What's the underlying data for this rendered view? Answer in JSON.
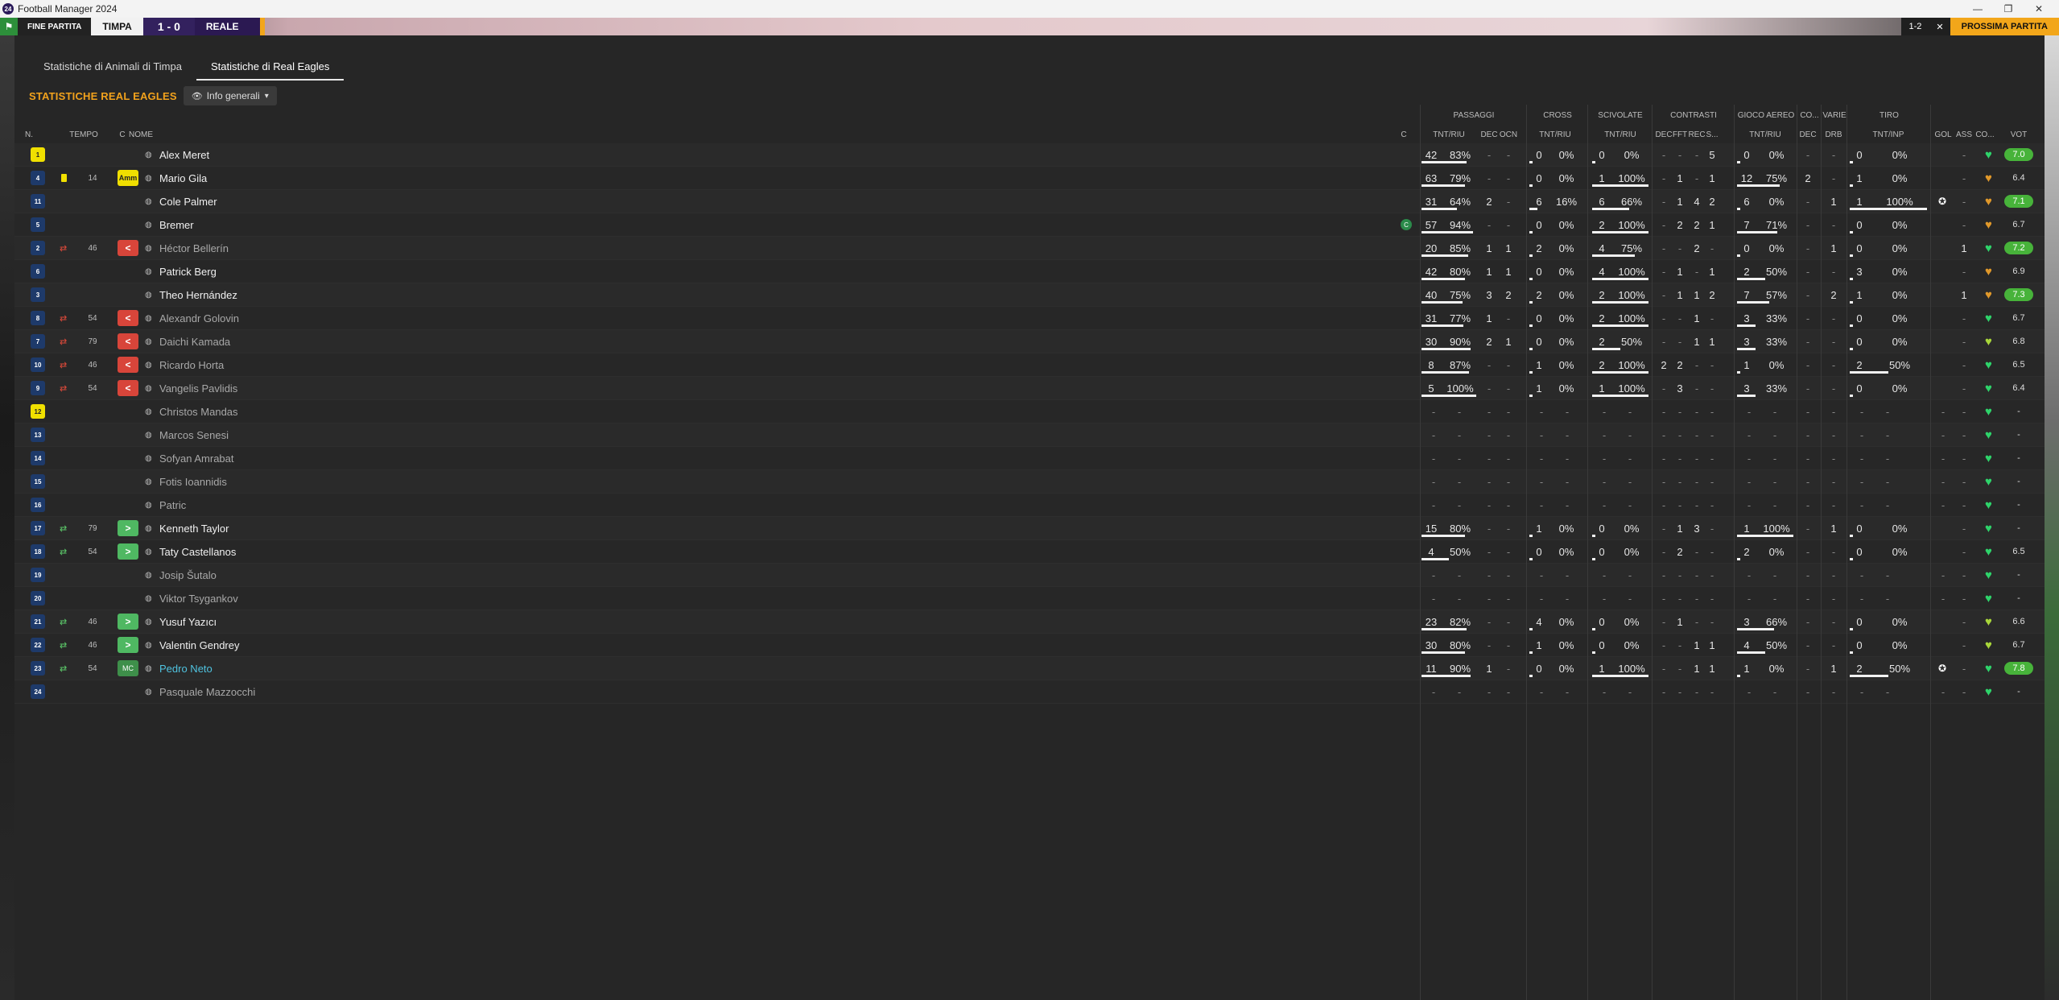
{
  "window": {
    "title": "Football Manager 2024",
    "logo": "24",
    "controls": [
      "—",
      "❐",
      "✕"
    ]
  },
  "topbar": {
    "end_label": "FINE PARTITA",
    "team_home": "TIMPA",
    "score": "1 - 0",
    "team_away": "REALE",
    "right1": "1-2",
    "right2": "✕",
    "right3": "PROSSIMA PARTITA"
  },
  "tabs": [
    {
      "label": "Statistiche di Animali di Timpa",
      "active": false
    },
    {
      "label": "Statistiche di Real Eagles",
      "active": true
    }
  ],
  "section": {
    "title": "STATISTICHE REAL EAGLES",
    "dropdown": "Info generali"
  },
  "columns": {
    "left": {
      "n": "N.",
      "tempo": "TEMPO",
      "c": "C",
      "nome": "NOME",
      "c2": "C"
    },
    "groups": [
      {
        "label": "PASSAGGI"
      },
      {
        "label": "CROSS"
      },
      {
        "label": "SCIVOLATE"
      },
      {
        "label": "CONTRASTI"
      },
      {
        "label": "GIOCO AEREO"
      },
      {
        "label": "CO..."
      },
      {
        "label": "VARIE"
      },
      {
        "label": "TIRO"
      }
    ],
    "sub": [
      "TNT/RIU",
      "DEC",
      "OCN",
      "TNT/RIU",
      "TNT/RIU",
      "DEC",
      "FFT",
      "REC",
      "S...",
      "TNT/RIU",
      "DEC",
      "DRB",
      "TNT/INP",
      "GOL",
      "ASS",
      "CO...",
      "VOT"
    ]
  },
  "colors": {
    "accent": "#f2a21c",
    "sub_off": "#d8453a",
    "sub_on": "#4fb862",
    "rating_green": "#47b33a"
  },
  "players": [
    {
      "num": "1",
      "gk": true,
      "sub": "",
      "card": false,
      "min": "",
      "badge": "",
      "badge_text": "",
      "name": "Alex Meret",
      "dim": false,
      "hl": false,
      "cap": false,
      "pas": [
        "42",
        "83%",
        0.83
      ],
      "dec": "-",
      "ocn": "-",
      "cross": [
        "0",
        "0%",
        0
      ],
      "sciv": [
        "0",
        "0%",
        0
      ],
      "cdec": "-",
      "fft": "-",
      "rec": "-",
      "s": "5",
      "aer": [
        "0",
        "0%",
        0
      ],
      "codec": "-",
      "drb": "-",
      "tiro": [
        "0",
        "0%",
        0
      ],
      "pom": false,
      "gol": "",
      "ass": "-",
      "morale": "green",
      "vot": "7.0",
      "vot_green": true
    },
    {
      "num": "4",
      "gk": false,
      "sub": "",
      "card": true,
      "min": "14",
      "badge": "amm",
      "badge_text": "Amm",
      "name": "Mario Gila",
      "dim": false,
      "hl": false,
      "cap": false,
      "pas": [
        "63",
        "79%",
        0.79
      ],
      "dec": "-",
      "ocn": "-",
      "cross": [
        "0",
        "0%",
        0
      ],
      "sciv": [
        "1",
        "100%",
        1
      ],
      "cdec": "-",
      "fft": "1",
      "rec": "-",
      "s": "1",
      "aer": [
        "12",
        "75%",
        0.75
      ],
      "codec": "2",
      "drb": "-",
      "tiro": [
        "1",
        "0%",
        0
      ],
      "pom": false,
      "gol": "",
      "ass": "-",
      "morale": "orange",
      "vot": "6.4",
      "vot_green": false
    },
    {
      "num": "11",
      "gk": false,
      "sub": "",
      "card": false,
      "min": "",
      "badge": "",
      "badge_text": "",
      "name": "Cole Palmer",
      "dim": false,
      "hl": false,
      "cap": false,
      "pas": [
        "31",
        "64%",
        0.64
      ],
      "dec": "2",
      "ocn": "-",
      "cross": [
        "6",
        "16%",
        0.16
      ],
      "sciv": [
        "6",
        "66%",
        0.66
      ],
      "cdec": "-",
      "fft": "1",
      "rec": "4",
      "s": "2",
      "aer": [
        "6",
        "0%",
        0
      ],
      "codec": "-",
      "drb": "1",
      "tiro": [
        "1",
        "100%",
        1
      ],
      "pom": true,
      "gol": "",
      "ass": "-",
      "morale": "orange",
      "vot": "7.1",
      "vot_green": true
    },
    {
      "num": "5",
      "gk": false,
      "sub": "",
      "card": false,
      "min": "",
      "badge": "",
      "badge_text": "",
      "name": "Bremer",
      "dim": false,
      "hl": false,
      "cap": true,
      "pas": [
        "57",
        "94%",
        0.94
      ],
      "dec": "-",
      "ocn": "-",
      "cross": [
        "0",
        "0%",
        0
      ],
      "sciv": [
        "2",
        "100%",
        1
      ],
      "cdec": "-",
      "fft": "2",
      "rec": "2",
      "s": "1",
      "aer": [
        "7",
        "71%",
        0.71
      ],
      "codec": "-",
      "drb": "-",
      "tiro": [
        "0",
        "0%",
        0
      ],
      "pom": false,
      "gol": "",
      "ass": "-",
      "morale": "orange",
      "vot": "6.7",
      "vot_green": false
    },
    {
      "num": "2",
      "gk": false,
      "sub": "off",
      "card": false,
      "min": "46",
      "badge": "out",
      "badge_text": "<",
      "name": "Héctor Bellerín",
      "dim": true,
      "hl": false,
      "cap": false,
      "pas": [
        "20",
        "85%",
        0.85
      ],
      "dec": "1",
      "ocn": "1",
      "cross": [
        "2",
        "0%",
        0
      ],
      "sciv": [
        "4",
        "75%",
        0.75
      ],
      "cdec": "-",
      "fft": "-",
      "rec": "2",
      "s": "-",
      "aer": [
        "0",
        "0%",
        0
      ],
      "codec": "-",
      "drb": "1",
      "tiro": [
        "0",
        "0%",
        0
      ],
      "pom": false,
      "gol": "",
      "ass": "1",
      "morale": "green",
      "vot": "7.2",
      "vot_green": true
    },
    {
      "num": "6",
      "gk": false,
      "sub": "",
      "card": false,
      "min": "",
      "badge": "",
      "badge_text": "",
      "name": "Patrick Berg",
      "dim": false,
      "hl": false,
      "cap": false,
      "pas": [
        "42",
        "80%",
        0.8
      ],
      "dec": "1",
      "ocn": "1",
      "cross": [
        "0",
        "0%",
        0
      ],
      "sciv": [
        "4",
        "100%",
        1
      ],
      "cdec": "-",
      "fft": "1",
      "rec": "-",
      "s": "1",
      "aer": [
        "2",
        "50%",
        0.5
      ],
      "codec": "-",
      "drb": "-",
      "tiro": [
        "3",
        "0%",
        0
      ],
      "pom": false,
      "gol": "",
      "ass": "-",
      "morale": "orange",
      "vot": "6.9",
      "vot_green": false
    },
    {
      "num": "3",
      "gk": false,
      "sub": "",
      "card": false,
      "min": "",
      "badge": "",
      "badge_text": "",
      "name": "Theo Hernández",
      "dim": false,
      "hl": false,
      "cap": false,
      "pas": [
        "40",
        "75%",
        0.75
      ],
      "dec": "3",
      "ocn": "2",
      "cross": [
        "2",
        "0%",
        0
      ],
      "sciv": [
        "2",
        "100%",
        1
      ],
      "cdec": "-",
      "fft": "1",
      "rec": "1",
      "s": "2",
      "aer": [
        "7",
        "57%",
        0.57
      ],
      "codec": "-",
      "drb": "2",
      "tiro": [
        "1",
        "0%",
        0
      ],
      "pom": false,
      "gol": "",
      "ass": "1",
      "morale": "orange",
      "vot": "7.3",
      "vot_green": true
    },
    {
      "num": "8",
      "gk": false,
      "sub": "off",
      "card": false,
      "min": "54",
      "badge": "out",
      "badge_text": "<",
      "name": "Alexandr Golovin",
      "dim": true,
      "hl": false,
      "cap": false,
      "pas": [
        "31",
        "77%",
        0.77
      ],
      "dec": "1",
      "ocn": "-",
      "cross": [
        "0",
        "0%",
        0
      ],
      "sciv": [
        "2",
        "100%",
        1
      ],
      "cdec": "-",
      "fft": "-",
      "rec": "1",
      "s": "-",
      "aer": [
        "3",
        "33%",
        0.33
      ],
      "codec": "-",
      "drb": "-",
      "tiro": [
        "0",
        "0%",
        0
      ],
      "pom": false,
      "gol": "",
      "ass": "-",
      "morale": "green",
      "vot": "6.7",
      "vot_green": false
    },
    {
      "num": "7",
      "gk": false,
      "sub": "off",
      "card": false,
      "min": "79",
      "badge": "out",
      "badge_text": "<",
      "name": "Daichi Kamada",
      "dim": true,
      "hl": false,
      "cap": false,
      "pas": [
        "30",
        "90%",
        0.9
      ],
      "dec": "2",
      "ocn": "1",
      "cross": [
        "0",
        "0%",
        0
      ],
      "sciv": [
        "2",
        "50%",
        0.5
      ],
      "cdec": "-",
      "fft": "-",
      "rec": "1",
      "s": "1",
      "aer": [
        "3",
        "33%",
        0.33
      ],
      "codec": "-",
      "drb": "-",
      "tiro": [
        "0",
        "0%",
        0
      ],
      "pom": false,
      "gol": "",
      "ass": "-",
      "morale": "yellowgreen",
      "vot": "6.8",
      "vot_green": false
    },
    {
      "num": "10",
      "gk": false,
      "sub": "off",
      "card": false,
      "min": "46",
      "badge": "out",
      "badge_text": "<",
      "name": "Ricardo Horta",
      "dim": true,
      "hl": false,
      "cap": false,
      "pas": [
        "8",
        "87%",
        0.87
      ],
      "dec": "-",
      "ocn": "-",
      "cross": [
        "1",
        "0%",
        0
      ],
      "sciv": [
        "2",
        "100%",
        1
      ],
      "cdec": "2",
      "fft": "2",
      "rec": "-",
      "s": "-",
      "aer": [
        "1",
        "0%",
        0
      ],
      "codec": "-",
      "drb": "-",
      "tiro": [
        "2",
        "50%",
        0.5
      ],
      "pom": false,
      "gol": "",
      "ass": "-",
      "morale": "green",
      "vot": "6.5",
      "vot_green": false
    },
    {
      "num": "9",
      "gk": false,
      "sub": "off",
      "card": false,
      "min": "54",
      "badge": "out",
      "badge_text": "<",
      "name": "Vangelis Pavlidis",
      "dim": true,
      "hl": false,
      "cap": false,
      "pas": [
        "5",
        "100%",
        1
      ],
      "dec": "-",
      "ocn": "-",
      "cross": [
        "1",
        "0%",
        0
      ],
      "sciv": [
        "1",
        "100%",
        1
      ],
      "cdec": "-",
      "fft": "3",
      "rec": "-",
      "s": "-",
      "aer": [
        "3",
        "33%",
        0.33
      ],
      "codec": "-",
      "drb": "-",
      "tiro": [
        "0",
        "0%",
        0
      ],
      "pom": false,
      "gol": "",
      "ass": "-",
      "morale": "green",
      "vot": "6.4",
      "vot_green": false
    },
    {
      "num": "12",
      "gk": true,
      "sub": "",
      "card": false,
      "min": "",
      "badge": "",
      "badge_text": "",
      "name": "Christos Mandas",
      "dim": true,
      "hl": false,
      "cap": false,
      "empty": true,
      "morale": "green",
      "vot": "-"
    },
    {
      "num": "13",
      "gk": false,
      "sub": "",
      "card": false,
      "min": "",
      "badge": "",
      "badge_text": "",
      "name": "Marcos Senesi",
      "dim": true,
      "hl": false,
      "cap": false,
      "empty": true,
      "morale": "green",
      "vot": "-"
    },
    {
      "num": "14",
      "gk": false,
      "sub": "",
      "card": false,
      "min": "",
      "badge": "",
      "badge_text": "",
      "name": "Sofyan Amrabat",
      "dim": true,
      "hl": false,
      "cap": false,
      "empty": true,
      "morale": "green",
      "vot": "-"
    },
    {
      "num": "15",
      "gk": false,
      "sub": "",
      "card": false,
      "min": "",
      "badge": "",
      "badge_text": "",
      "name": "Fotis Ioannidis",
      "dim": true,
      "hl": false,
      "cap": false,
      "empty": true,
      "morale": "green",
      "vot": "-"
    },
    {
      "num": "16",
      "gk": false,
      "sub": "",
      "card": false,
      "min": "",
      "badge": "",
      "badge_text": "",
      "name": "Patric",
      "dim": true,
      "hl": false,
      "cap": false,
      "empty": true,
      "morale": "green",
      "vot": "-"
    },
    {
      "num": "17",
      "gk": false,
      "sub": "on",
      "card": false,
      "min": "79",
      "badge": "in",
      "badge_text": ">",
      "name": "Kenneth Taylor",
      "dim": false,
      "hl": false,
      "cap": false,
      "pas": [
        "15",
        "80%",
        0.8
      ],
      "dec": "-",
      "ocn": "-",
      "cross": [
        "1",
        "0%",
        0
      ],
      "sciv": [
        "0",
        "0%",
        0
      ],
      "cdec": "-",
      "fft": "1",
      "rec": "3",
      "s": "-",
      "aer": [
        "1",
        "100%",
        1
      ],
      "codec": "-",
      "drb": "1",
      "tiro": [
        "0",
        "0%",
        0
      ],
      "pom": false,
      "gol": "",
      "ass": "-",
      "morale": "green",
      "vot": "-",
      "vot_green": false
    },
    {
      "num": "18",
      "gk": false,
      "sub": "on",
      "card": false,
      "min": "54",
      "badge": "in",
      "badge_text": ">",
      "name": "Taty Castellanos",
      "dim": false,
      "hl": false,
      "cap": false,
      "pas": [
        "4",
        "50%",
        0.5
      ],
      "dec": "-",
      "ocn": "-",
      "cross": [
        "0",
        "0%",
        0
      ],
      "sciv": [
        "0",
        "0%",
        0
      ],
      "cdec": "-",
      "fft": "2",
      "rec": "-",
      "s": "-",
      "aer": [
        "2",
        "0%",
        0
      ],
      "codec": "-",
      "drb": "-",
      "tiro": [
        "0",
        "0%",
        0
      ],
      "pom": false,
      "gol": "",
      "ass": "-",
      "morale": "green",
      "vot": "6.5",
      "vot_green": false
    },
    {
      "num": "19",
      "gk": false,
      "sub": "",
      "card": false,
      "min": "",
      "badge": "",
      "badge_text": "",
      "name": "Josip Šutalo",
      "dim": true,
      "hl": false,
      "cap": false,
      "empty": true,
      "morale": "green",
      "vot": "-"
    },
    {
      "num": "20",
      "gk": false,
      "sub": "",
      "card": false,
      "min": "",
      "badge": "",
      "badge_text": "",
      "name": "Viktor Tsygankov",
      "dim": true,
      "hl": false,
      "cap": false,
      "empty": true,
      "morale": "green",
      "vot": "-"
    },
    {
      "num": "21",
      "gk": false,
      "sub": "on",
      "card": false,
      "min": "46",
      "badge": "in",
      "badge_text": ">",
      "name": "Yusuf Yazıcı",
      "dim": false,
      "hl": false,
      "cap": false,
      "pas": [
        "23",
        "82%",
        0.82
      ],
      "dec": "-",
      "ocn": "-",
      "cross": [
        "4",
        "0%",
        0
      ],
      "sciv": [
        "0",
        "0%",
        0
      ],
      "cdec": "-",
      "fft": "1",
      "rec": "-",
      "s": "-",
      "aer": [
        "3",
        "66%",
        0.66
      ],
      "codec": "-",
      "drb": "-",
      "tiro": [
        "0",
        "0%",
        0
      ],
      "pom": false,
      "gol": "",
      "ass": "-",
      "morale": "yellowgreen",
      "vot": "6.6",
      "vot_green": false
    },
    {
      "num": "22",
      "gk": false,
      "sub": "on",
      "card": false,
      "min": "46",
      "badge": "in",
      "badge_text": ">",
      "name": "Valentin Gendrey",
      "dim": false,
      "hl": false,
      "cap": false,
      "pas": [
        "30",
        "80%",
        0.8
      ],
      "dec": "-",
      "ocn": "-",
      "cross": [
        "1",
        "0%",
        0
      ],
      "sciv": [
        "0",
        "0%",
        0
      ],
      "cdec": "-",
      "fft": "-",
      "rec": "1",
      "s": "1",
      "aer": [
        "4",
        "50%",
        0.5
      ],
      "codec": "-",
      "drb": "-",
      "tiro": [
        "0",
        "0%",
        0
      ],
      "pom": false,
      "gol": "",
      "ass": "-",
      "morale": "yellowgreen",
      "vot": "6.7",
      "vot_green": false
    },
    {
      "num": "23",
      "gk": false,
      "sub": "on",
      "card": false,
      "min": "54",
      "badge": "mc",
      "badge_text": "MC",
      "name": "Pedro Neto",
      "dim": false,
      "hl": true,
      "cap": false,
      "pas": [
        "11",
        "90%",
        0.9
      ],
      "dec": "1",
      "ocn": "-",
      "cross": [
        "0",
        "0%",
        0
      ],
      "sciv": [
        "1",
        "100%",
        1
      ],
      "cdec": "-",
      "fft": "-",
      "rec": "1",
      "s": "1",
      "aer": [
        "1",
        "0%",
        0
      ],
      "codec": "-",
      "drb": "1",
      "tiro": [
        "2",
        "50%",
        0.5
      ],
      "pom": true,
      "gol": "",
      "ass": "-",
      "morale": "green",
      "vot": "7.8",
      "vot_green": true
    },
    {
      "num": "24",
      "gk": false,
      "sub": "",
      "card": false,
      "min": "",
      "badge": "",
      "badge_text": "",
      "name": "Pasquale Mazzocchi",
      "dim": true,
      "hl": false,
      "cap": false,
      "empty": true,
      "morale": "green",
      "vot": "-"
    }
  ]
}
